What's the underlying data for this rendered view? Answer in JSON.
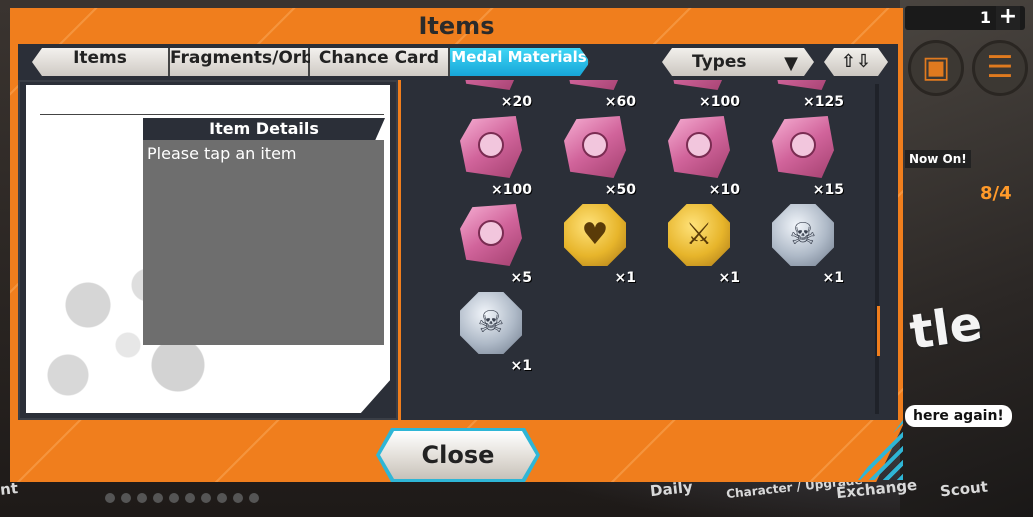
{
  "window": {
    "title": "Items"
  },
  "tabs": [
    {
      "label": "Items",
      "active": false
    },
    {
      "label": "Fragments/Orbs",
      "active": false
    },
    {
      "label": "Chance Card",
      "active": false
    },
    {
      "label": "Medal Materials",
      "active": true
    }
  ],
  "filters": {
    "types_label": "Types",
    "sort_icon": "sort-arrows-icon"
  },
  "details": {
    "header": "Item Details",
    "placeholder": "Please tap an item"
  },
  "items": [
    {
      "kind": "shard",
      "qty": "×20"
    },
    {
      "kind": "shard",
      "qty": "×60"
    },
    {
      "kind": "shard",
      "qty": "×100"
    },
    {
      "kind": "shard",
      "qty": "×125"
    },
    {
      "kind": "shard",
      "qty": "×100"
    },
    {
      "kind": "shard",
      "qty": "×50"
    },
    {
      "kind": "shard",
      "qty": "×10"
    },
    {
      "kind": "shard",
      "qty": "×15"
    },
    {
      "kind": "shard",
      "qty": "×5"
    },
    {
      "kind": "gold-heart-medal",
      "qty": "×1"
    },
    {
      "kind": "gold-sword-medal",
      "qty": "×1"
    },
    {
      "kind": "silver-skull-medal",
      "qty": "×1"
    },
    {
      "kind": "silver-skull-medal",
      "qty": "×1"
    }
  ],
  "close_label": "Close",
  "background": {
    "gem_count": "1",
    "plus": "+",
    "now_on": "Now On!",
    "progress": "8/4",
    "banner_text": "tle",
    "speech": "here again!",
    "nav": [
      "nt",
      "Daily",
      "Character / Upgrade",
      "Exchange",
      "Scout"
    ]
  },
  "colors": {
    "accent": "#f07e1d",
    "active_tab": "#17a6d8",
    "panel_inner": "#2b2f38"
  }
}
